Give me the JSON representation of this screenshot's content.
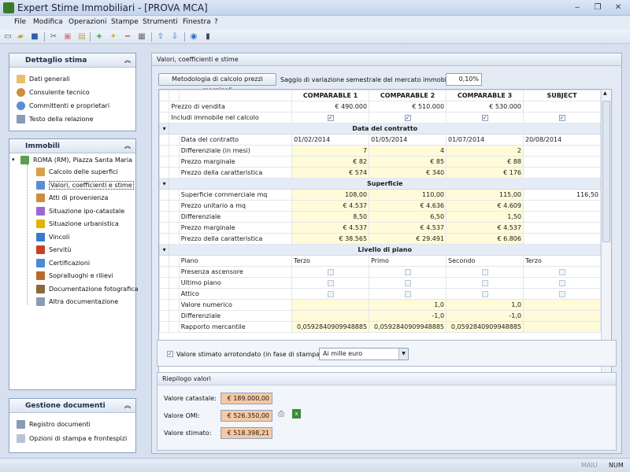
{
  "window": {
    "title": "Expert Stime Immobiliari - [PROVA MCA]"
  },
  "menu": [
    "File",
    "Modifica",
    "Operazioni",
    "Stampe",
    "Strumenti",
    "Finestra",
    "?"
  ],
  "sidebar": {
    "dettaglio": {
      "title": "Dettaglio stima",
      "items": [
        "Dati generali",
        "Consulente tecnico",
        "Committenti e proprietari",
        "Testo della relazione"
      ]
    },
    "immobili": {
      "title": "Immobili",
      "root": "ROMA (RM), Piazza Santa Maria",
      "items": [
        "Calcolo delle superfici",
        "Valori, coefficienti e stime",
        "Atti di provenienza",
        "Situazione ipo-catastale",
        "Situazione urbanistica",
        "Vincoli",
        "Servitù",
        "Certificazioni",
        "Sopralluoghi e rilievi",
        "Documentazione fotografica",
        "Altra documentazione"
      ]
    },
    "documenti": {
      "title": "Gestione documenti",
      "items": [
        "Registro documenti",
        "Opzioni di stampa e frontespizi"
      ]
    }
  },
  "main": {
    "title": "Valori, coefficienti e stime",
    "method_button": "Metodologia di calcolo prezzi marginali",
    "rate_label": "Saggio di variazione semestrale del mercato immobiliare:",
    "rate_value": "0,10%",
    "columns": [
      "COMPARABLE 1",
      "COMPARABLE 2",
      "COMPARABLE 3",
      "SUBJECT"
    ],
    "price_label": "Prezzo di vendita",
    "prices": [
      "€ 490.000",
      "€ 510.000",
      "€ 530.000",
      ""
    ],
    "include_label": "Includi immobile nel calcolo",
    "contract": {
      "title": "Data del contratto",
      "rows": [
        {
          "label": "Data del contratto",
          "v": [
            "01/02/2014",
            "01/05/2014",
            "01/07/2014",
            "20/08/2014"
          ]
        },
        {
          "label": "Differenziale (in mesi)",
          "v": [
            "7",
            "4",
            "2",
            ""
          ]
        },
        {
          "label": "Prezzo marginale",
          "v": [
            "€ 82",
            "€ 85",
            "€ 88",
            ""
          ]
        },
        {
          "label": "Prezzo della caratteristica",
          "v": [
            "€ 574",
            "€ 340",
            "€ 176",
            ""
          ]
        }
      ]
    },
    "surface": {
      "title": "Superficie",
      "rows": [
        {
          "label": "Superficie commerciale mq",
          "v": [
            "108,00",
            "110,00",
            "115,00",
            "116,50"
          ]
        },
        {
          "label": "Prezzo unitario a mq",
          "v": [
            "€ 4.537",
            "€ 4.636",
            "€ 4.609",
            ""
          ]
        },
        {
          "label": "Differenziale",
          "v": [
            "8,50",
            "6,50",
            "1,50",
            ""
          ]
        },
        {
          "label": "Prezzo marginale",
          "v": [
            "€ 4.537",
            "€ 4.537",
            "€ 4.537",
            ""
          ]
        },
        {
          "label": "Prezzo della caratteristica",
          "v": [
            "€ 38.565",
            "€ 29.491",
            "€ 6.806",
            ""
          ]
        }
      ]
    },
    "floor": {
      "title": "Livello di piano",
      "piano_label": "Piano",
      "piano": [
        "Terzo",
        "Primo",
        "Secondo",
        "Terzo"
      ],
      "check_rows": [
        "Presenza ascensore",
        "Ultimo piano",
        "Attico"
      ],
      "rows": [
        {
          "label": "Valore numerico",
          "v": [
            "",
            "1,0",
            "1,0",
            ""
          ]
        },
        {
          "label": "Differenziale",
          "v": [
            "",
            "-1,0",
            "-1,0",
            ""
          ]
        },
        {
          "label": "Rapporto mercantile",
          "v": [
            "0,0592840909948885",
            "0,0592840909948885",
            "0,0592840909948885",
            ""
          ]
        }
      ]
    },
    "rounded_label": "Valore stimato arrotondato (in fase di stampa)",
    "rounded_option": "Ai mille euro",
    "summary": {
      "title": "Riepilogo valori",
      "rows": [
        {
          "label": "Valore catastale:",
          "value": "€ 189.000,00"
        },
        {
          "label": "Valore OMI:",
          "value": "€ 526.350,00"
        },
        {
          "label": "Valore stimato:",
          "value": "€ 518.398,21"
        }
      ]
    }
  },
  "status": {
    "maiu": "MAIU",
    "num": "NUM"
  },
  "colors": {
    "accent_cell": "#f5c9a3",
    "yellow_cell": "#fffbd8"
  }
}
